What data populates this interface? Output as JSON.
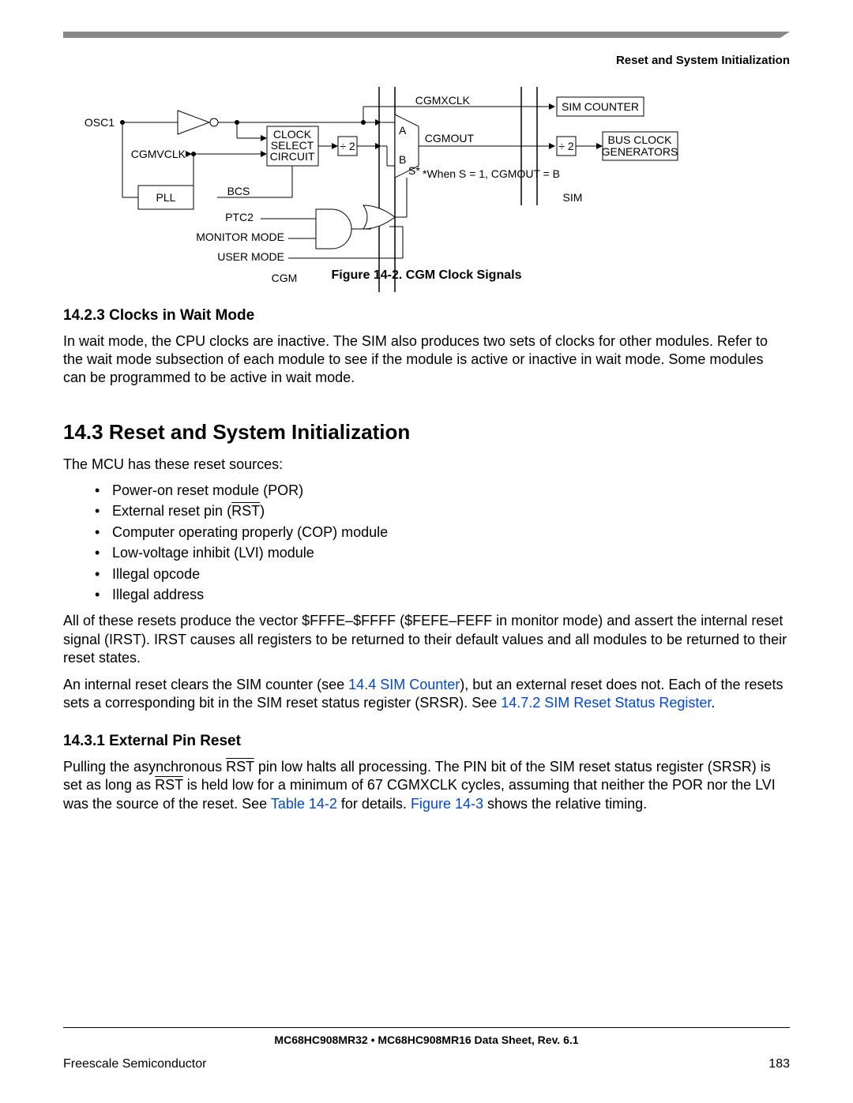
{
  "header": {
    "section_title": "Reset and System Initialization"
  },
  "diagram": {
    "labels": {
      "osc1": "OSC1",
      "cgmvclk": "CGMVCLK",
      "pll": "PLL",
      "clock_select": "CLOCK SELECT CIRCUIT",
      "div2_a": "÷ 2",
      "a": "A",
      "b": "B",
      "s": "S*",
      "cgmxclk": "CGMXCLK",
      "cgmout": "CGMOUT",
      "note": "*When S = 1, CGMOUT = B",
      "bcs": "BCS",
      "ptc2": "PTC2",
      "monitor_mode": "MONITOR MODE",
      "user_mode": "USER MODE",
      "cgm": "CGM",
      "sim_counter": "SIM COUNTER",
      "div2_b": "÷ 2",
      "bus_clock": "BUS CLOCK GENERATORS",
      "sim": "SIM"
    },
    "caption": "Figure 14-2. CGM Clock Signals"
  },
  "sections": {
    "s1423": {
      "heading": "14.2.3  Clocks in Wait Mode",
      "p1": "In wait mode, the CPU clocks are inactive. The SIM also produces two sets of clocks for other modules. Refer to the wait mode subsection of each module to see if the module is active or inactive in wait mode. Some modules can be programmed to be active in wait mode."
    },
    "s143": {
      "heading": "14.3  Reset and System Initialization",
      "intro": "The MCU has these reset sources:",
      "bullets": [
        "Power-on reset module (POR)",
        "External reset pin (",
        "Computer operating properly (COP) module",
        "Low-voltage inhibit (LVI) module",
        "Illegal opcode",
        "Illegal address"
      ],
      "rst_over": "RST",
      "bullet2_close": ")",
      "p2": "All of these resets produce the vector $FFFE–$FFFF ($FEFE–FEFF in monitor mode) and assert the internal reset signal (IRST). IRST causes all registers to be returned to their default values and all modules to be returned to their reset states.",
      "p3a": "An internal reset clears the SIM counter (see ",
      "p3_link1": "14.4 SIM Counter",
      "p3b": "), but an external reset does not. Each of the resets sets a corresponding bit in the SIM reset status register (SRSR). See ",
      "p3_link2": "14.7.2 SIM Reset Status Register",
      "p3c": "."
    },
    "s1431": {
      "heading": "14.3.1  External Pin Reset",
      "p1a": "Pulling the asynchronous ",
      "rst_over1": "RST",
      "p1b": " pin low halts all processing. The PIN bit of the SIM reset status register (SRSR) is set as long as ",
      "rst_over2": "RST",
      "p1c": " is held low for a minimum of 67 CGMXCLK cycles, assuming that neither the POR nor the LVI was the source of the reset. See ",
      "link1": "Table 14-2",
      "p1d": " for details. ",
      "link2": "Figure 14-3",
      "p1e": " shows the relative timing."
    }
  },
  "footer": {
    "center": "MC68HC908MR32 • MC68HC908MR16 Data Sheet, Rev. 6.1",
    "left": "Freescale Semiconductor",
    "right": "183"
  }
}
